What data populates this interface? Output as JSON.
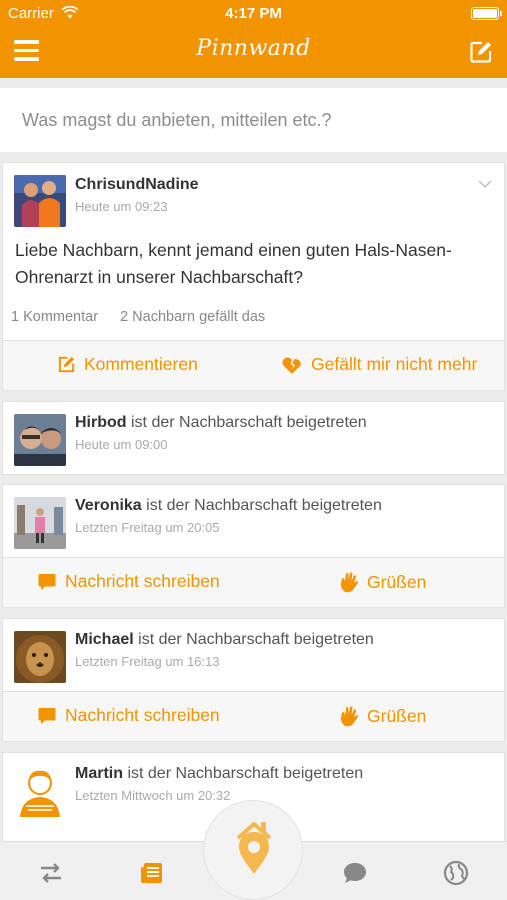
{
  "status_bar": {
    "carrier": "Carrier",
    "time": "4:17 PM"
  },
  "nav": {
    "title": "Pinnwand"
  },
  "composer": {
    "placeholder": "Was magst du anbieten, mitteilen etc.?"
  },
  "post": {
    "author": "ChrisundNadine",
    "timestamp": "Heute um 09:23",
    "text": "Liebe Nachbarn, kennt jemand einen guten Hals-Nasen-Ohrenarzt in unserer Nachbarschaft?",
    "comments": "1 Kommentar",
    "likes": "2 Nachbarn gefällt das",
    "comment_label": "Kommentieren",
    "unlike_label": "Gefällt mir nicht mehr"
  },
  "join_action": "ist der Nachbarschaft beigetreten",
  "message_label": "Nachricht schreiben",
  "greet_label": "Grüßen",
  "joins": [
    {
      "name": "Hirbod",
      "timestamp": "Heute um 09:00"
    },
    {
      "name": "Veronika",
      "timestamp": "Letzten Freitag um 20:05"
    },
    {
      "name": "Michael",
      "timestamp": "Letzten Freitag um 16:13"
    },
    {
      "name": "Martin",
      "timestamp": "Letzten Mittwoch um 20:32"
    }
  ],
  "colors": {
    "accent": "#f29400",
    "background": "#ececec",
    "muted": "#aaaaaa"
  },
  "icons": {
    "nav": [
      "menu-icon",
      "compose-icon"
    ],
    "tabs": [
      "swap-icon",
      "newsfeed-icon",
      "home-location-icon",
      "chat-icon",
      "globe-icon"
    ]
  }
}
